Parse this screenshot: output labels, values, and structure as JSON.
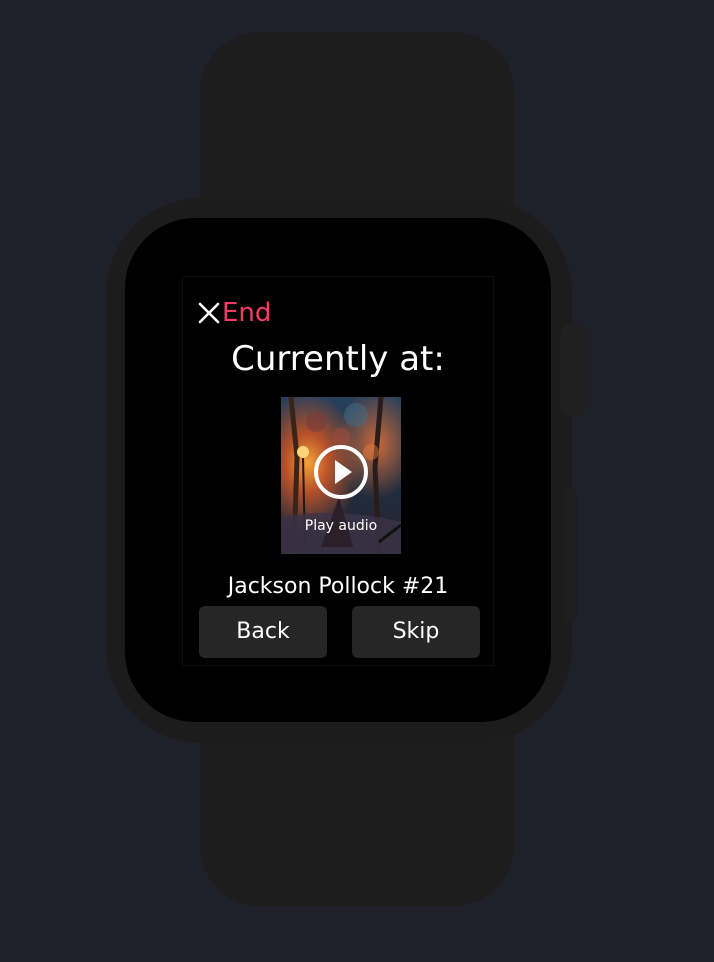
{
  "watch_screen": {
    "end_label": "End",
    "heading": "Currently at:",
    "artwork": {
      "play_label": "Play audio"
    },
    "track_title": "Jackson Pollock #21",
    "buttons": {
      "back": "Back",
      "skip": "Skip"
    }
  },
  "icons": {
    "close": "close-icon",
    "play": "play-icon"
  },
  "colors": {
    "background": "#1f2029",
    "watch_body": "#1c1c1c",
    "screen": "#000000",
    "accent": "#f43b67",
    "button_bg": "#262626",
    "text": "#ffffff"
  }
}
